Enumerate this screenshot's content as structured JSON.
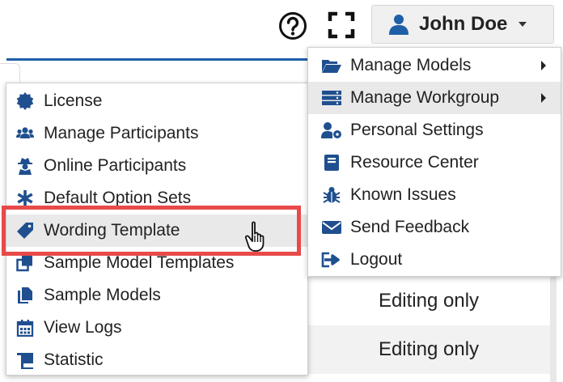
{
  "header": {
    "user_name": "John Doe",
    "icons": [
      "help-icon",
      "fullscreen-icon",
      "user-icon"
    ]
  },
  "accent_color": "#1f5fa8",
  "highlight_color": "#e84a4a",
  "left_menu": {
    "items": [
      {
        "label": "License",
        "icon": "certificate-icon"
      },
      {
        "label": "Manage Participants",
        "icon": "users-icon"
      },
      {
        "label": "Online Participants",
        "icon": "user-secret-icon"
      },
      {
        "label": "Default Option Sets",
        "icon": "asterisk-icon"
      },
      {
        "label": "Wording Template",
        "icon": "tag-icon",
        "highlighted": true
      },
      {
        "label": "Sample Model Templates",
        "icon": "clone-icon"
      },
      {
        "label": "Sample Models",
        "icon": "files-icon"
      },
      {
        "label": "View Logs",
        "icon": "calendar-icon"
      },
      {
        "label": "Statistic",
        "icon": "cart-icon"
      }
    ]
  },
  "right_menu": {
    "items": [
      {
        "label": "Manage Models",
        "icon": "folder-open-icon",
        "has_submenu": true
      },
      {
        "label": "Manage Workgroup",
        "icon": "server-icon",
        "has_submenu": true,
        "active": true
      },
      {
        "label": "Personal Settings",
        "icon": "user-cog-icon"
      },
      {
        "label": "Resource Center",
        "icon": "book-icon"
      },
      {
        "label": "Known Issues",
        "icon": "bug-icon"
      },
      {
        "label": "Send Feedback",
        "icon": "envelope-icon"
      },
      {
        "label": "Logout",
        "icon": "sign-out-icon"
      }
    ]
  },
  "background_table": {
    "rows": [
      "Editing only",
      "Editing only"
    ]
  }
}
